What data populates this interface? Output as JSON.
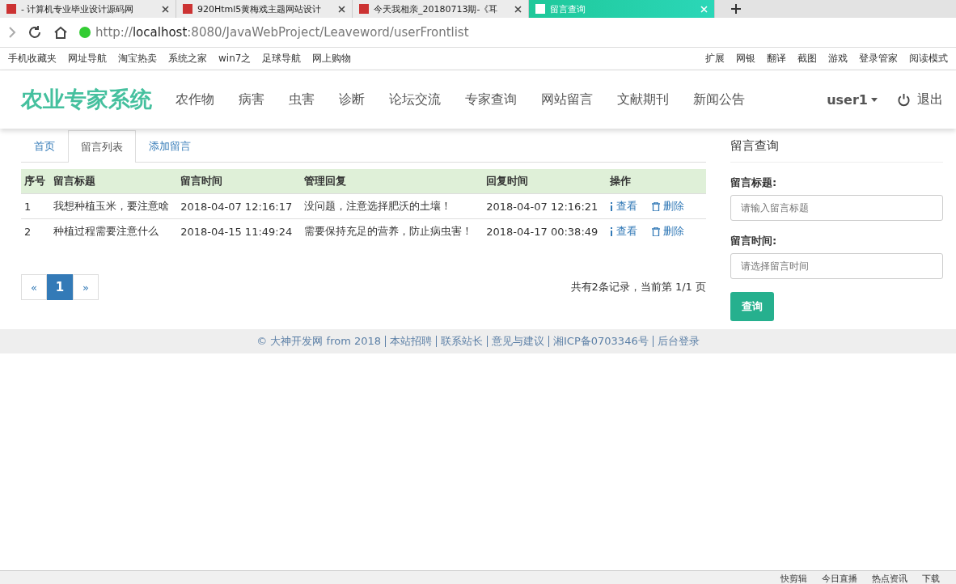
{
  "browser": {
    "tabs": [
      {
        "title": "- 计算机专业毕业设计源码网",
        "selected": false
      },
      {
        "title": "920Html5黄梅戏主题网站设计",
        "selected": false
      },
      {
        "title": "今天我相亲_20180713期-《耳",
        "selected": false
      },
      {
        "title": "留言查询",
        "selected": true
      }
    ],
    "url": "http://**localhost**:8080/JavaWebProject/Leaveword/userFrontlist",
    "bookmarks": [
      "手机收藏夹",
      "网址导航",
      "淘宝热卖",
      "系统之家",
      "win7之",
      "足球导航",
      "网上购物"
    ],
    "tools": [
      "扩展",
      "网银",
      "翻译",
      "截图",
      "游戏",
      "登录管家",
      "阅读模式"
    ]
  },
  "site": {
    "logo": "农业专家系统",
    "nav": [
      "农作物",
      "病害",
      "虫害",
      "诊断",
      "论坛交流",
      "专家查询",
      "网站留言",
      "文献期刊",
      "新闻公告"
    ],
    "user": "user1",
    "logout": "退出"
  },
  "tabs": [
    {
      "label": "首页",
      "selected": false
    },
    {
      "label": "留言列表",
      "selected": true
    },
    {
      "label": "添加留言",
      "selected": false
    }
  ],
  "table": {
    "columns": [
      "序号",
      "留言标题",
      "留言时间",
      "管理回复",
      "回复时间",
      "操作"
    ],
    "rows": [
      {
        "cells": [
          "1",
          "我想种植玉米，要注意啥",
          "2018-04-07 12:16:17",
          "没问题，注意选择肥沃的土壤！",
          "2018-04-07 12:16:21"
        ],
        "actions": [
          "查看",
          "删除"
        ]
      },
      {
        "cells": [
          "2",
          "种植过程需要注意什么",
          "2018-04-15 11:49:24",
          "需要保持充足的营养，防止病虫害！",
          "2018-04-17 00:38:49"
        ],
        "actions": [
          "查看",
          "删除"
        ]
      }
    ]
  },
  "pagination": {
    "prev": "«",
    "pages": [
      {
        "label": "1",
        "selected": true
      }
    ],
    "next": "»",
    "summary": "共有2条记录，当前第 1/1 页"
  },
  "sidebar": {
    "title": "留言查询",
    "fields": [
      {
        "label": "留言标题:",
        "placeholder": "请输入留言标题"
      },
      {
        "label": "留言时间:",
        "placeholder": "请选择留言时间"
      }
    ],
    "button": "查询"
  },
  "footer": [
    "© 大神开发网 from 2018",
    "本站招聘",
    "联系站长",
    "意见与建议",
    "湘ICP备0703346号",
    "后台登录"
  ],
  "status_bar": [
    "快剪辑",
    "今日直播",
    "热点资讯",
    "下载"
  ]
}
